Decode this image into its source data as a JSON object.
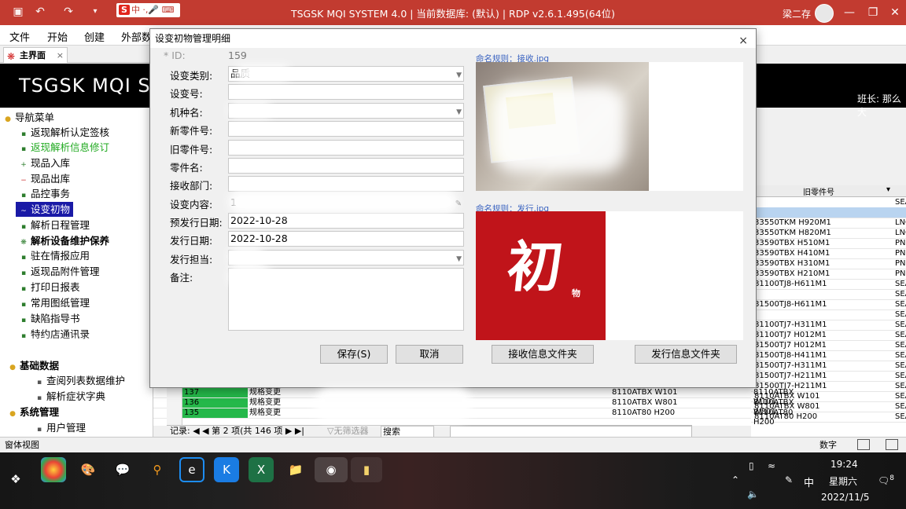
{
  "window": {
    "title": "TSGSK MQI SYSTEM 4.0 | 当前数据库: (默认) | RDP v2.6.1.495(64位)",
    "user": "梁二存",
    "ime_label": "中"
  },
  "ribbon": {
    "items": [
      "文件",
      "开始",
      "创建",
      "外部数"
    ]
  },
  "main_tab": {
    "label": "主界面"
  },
  "banner": {
    "brand": "TSGSK MQI SY",
    "shift_leader": "班长: 那么大"
  },
  "nav": {
    "items": [
      "导航菜单",
      "返现解析认定签核",
      "返现解析信息修订",
      "现品入库",
      "现品出库",
      "品控事务",
      "设变初物",
      "解析日程管理",
      "解析设备维护保养",
      "驻在情报应用",
      "返现品附件管理",
      "打印日报表",
      "常用图纸管理",
      "缺陷指导书",
      "特约店通讯录",
      "基础数据",
      "查阅列表数据维护",
      "解析症状字典",
      "系统管理",
      "用户管理"
    ]
  },
  "grid": {
    "header": "旧零件号",
    "rows": [
      [
        "",
        "SEA"
      ],
      [
        "",
        ""
      ],
      [
        "33550TKM H920M1",
        "LNG"
      ],
      [
        "33550TKM H820M1",
        "LNG"
      ],
      [
        "33590TBX H510M1",
        "PNG"
      ],
      [
        "33590TBX H410M1",
        "PNG"
      ],
      [
        "33590TBX H310M1",
        "PNG"
      ],
      [
        "33590TBX H210M1",
        "PNG"
      ],
      [
        "81100TJ8-H611M1",
        "SEA"
      ],
      [
        "",
        "SEA"
      ],
      [
        "81500TJ8-H611M1",
        "SEA"
      ],
      [
        "",
        "SEA"
      ],
      [
        "81100TJ7-H311M1",
        "SEA"
      ],
      [
        "81100TJ7 H012M1",
        "SEA"
      ],
      [
        "81500TJ7 H012M1",
        "SEA"
      ],
      [
        "81500TJ8-H411M1",
        "SEA"
      ],
      [
        "81500TJ7-H311M1",
        "SEA"
      ],
      [
        "81500TJ7-H211M1",
        "SEA"
      ],
      [
        "81500TJ7-H211M1",
        "SEA"
      ],
      [
        "8110ATBX W101",
        "SEA"
      ],
      [
        "8110ATBX W801",
        "SEA"
      ],
      [
        "8110AT80 H200",
        "SEA"
      ]
    ]
  },
  "grid2": {
    "rows": [
      {
        "id": "137",
        "type": "规格变更",
        "pa": "8110ATBX W101",
        "pb": "8110ATBX W101"
      },
      {
        "id": "136",
        "type": "规格变更",
        "pa": "8110ATBX W801",
        "pb": "8110ATBX W801"
      },
      {
        "id": "135",
        "type": "规格变更",
        "pa": "8110AT80 H200",
        "pb": "8110AT80 H200"
      }
    ],
    "nav_record": "记录: ◀ ◀ 第 2 项(共 146 项 ▶ ▶|",
    "nav_filter": "无筛选器",
    "nav_search": "搜索"
  },
  "status": {
    "left": "窗体视图",
    "right": "数字"
  },
  "dialog": {
    "title": "设变初物管理明细",
    "id_label": "* ID:",
    "id_value": "159",
    "labels": [
      "设变类别:",
      "设变号:",
      "机种名:",
      "新零件号:",
      "旧零件号:",
      "零件名:",
      "接收部门:",
      "设变内容:",
      "预发行日期:",
      "发行日期:",
      "发行担当:",
      "备注:"
    ],
    "category_value": "品质",
    "content_value": "1",
    "pre_issue_date": "2022-10-28",
    "issue_date": "2022-10-28",
    "buttons": {
      "save": "保存(S)",
      "cancel": "取消",
      "recv_folder": "接收信息文件夹",
      "issue_folder": "发行信息文件夹"
    },
    "img1_caption": "命名规则：接收.jpg",
    "img2_caption": "命名规则：发行.jpg",
    "img2_text_big": "初",
    "img2_text_small": "物",
    "close": "×"
  },
  "taskbar": {
    "time": "19:24",
    "weekday": "星期六",
    "date": "2022/11/5",
    "ime": "中",
    "badge": "8"
  }
}
